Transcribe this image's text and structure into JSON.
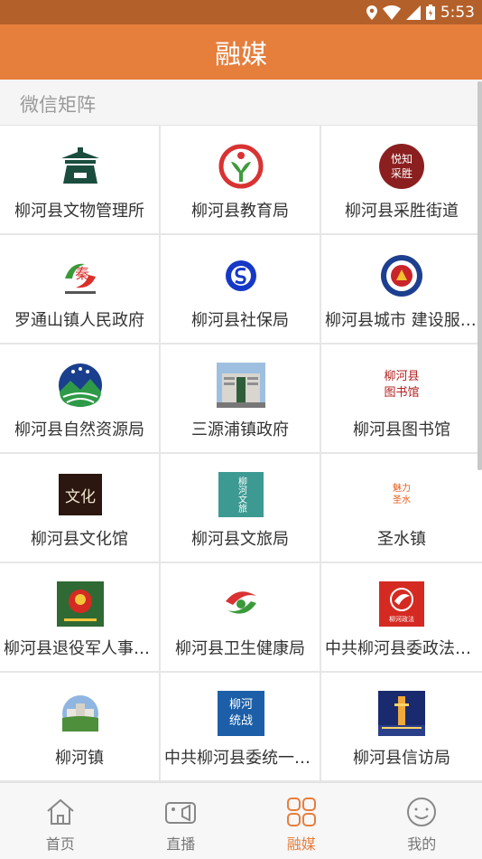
{
  "status_bar": {
    "time": "5:53"
  },
  "header": {
    "title": "融媒"
  },
  "section": {
    "label": "微信矩阵"
  },
  "grid": {
    "rows": [
      [
        {
          "label": "柳河县文物管理所",
          "icon": "museum-logo-icon"
        },
        {
          "label": "柳河县教育局",
          "icon": "education-logo-icon"
        },
        {
          "label": "柳河县采胜街道",
          "icon": "caisheng-logo-icon",
          "logo_text": "悦知\n采胜"
        }
      ],
      [
        {
          "label": "罗通山镇人民政府",
          "icon": "luotongshan-logo-icon",
          "logo_text": "秦"
        },
        {
          "label": "柳河县社保局",
          "icon": "social-security-logo-icon"
        },
        {
          "label": "柳河县城市 建设服务中心",
          "icon": "urban-construction-logo-icon"
        }
      ],
      [
        {
          "label": "柳河县自然资源局",
          "icon": "natural-resources-logo-icon"
        },
        {
          "label": "三源浦镇政府",
          "icon": "building-photo-icon"
        },
        {
          "label": "柳河县图书馆",
          "icon": "library-logo-icon",
          "logo_text": "柳河县\n图书馆"
        }
      ],
      [
        {
          "label": "柳河县文化馆",
          "icon": "culture-center-logo-icon",
          "logo_text": "文化"
        },
        {
          "label": "柳河县文旅局",
          "icon": "tourism-logo-icon",
          "logo_text": "柳河文旅"
        },
        {
          "label": "圣水镇",
          "icon": "shengshui-logo-icon",
          "logo_text": "魅力圣水"
        }
      ],
      [
        {
          "label": "柳河县退役军人事务局",
          "icon": "veterans-logo-icon"
        },
        {
          "label": "柳河县卫生健康局",
          "icon": "health-logo-icon"
        },
        {
          "label": "中共柳河县委政法委员会",
          "icon": "political-legal-logo-icon",
          "logo_text": "柳河政法"
        }
      ],
      [
        {
          "label": "柳河镇",
          "icon": "liuhe-town-logo-icon"
        },
        {
          "label": "中共柳河县委统一战线工作部",
          "icon": "united-front-logo-icon",
          "logo_text": "柳河\n统战"
        },
        {
          "label": "柳河县信访局",
          "icon": "petition-logo-icon"
        }
      ]
    ]
  },
  "tabbar": {
    "tabs": [
      {
        "label": "首页",
        "icon": "home-icon"
      },
      {
        "label": "直播",
        "icon": "video-camera-icon"
      },
      {
        "label": "融媒",
        "icon": "grid-icon",
        "active": true
      },
      {
        "label": "我的",
        "icon": "smiley-face-icon"
      }
    ]
  }
}
